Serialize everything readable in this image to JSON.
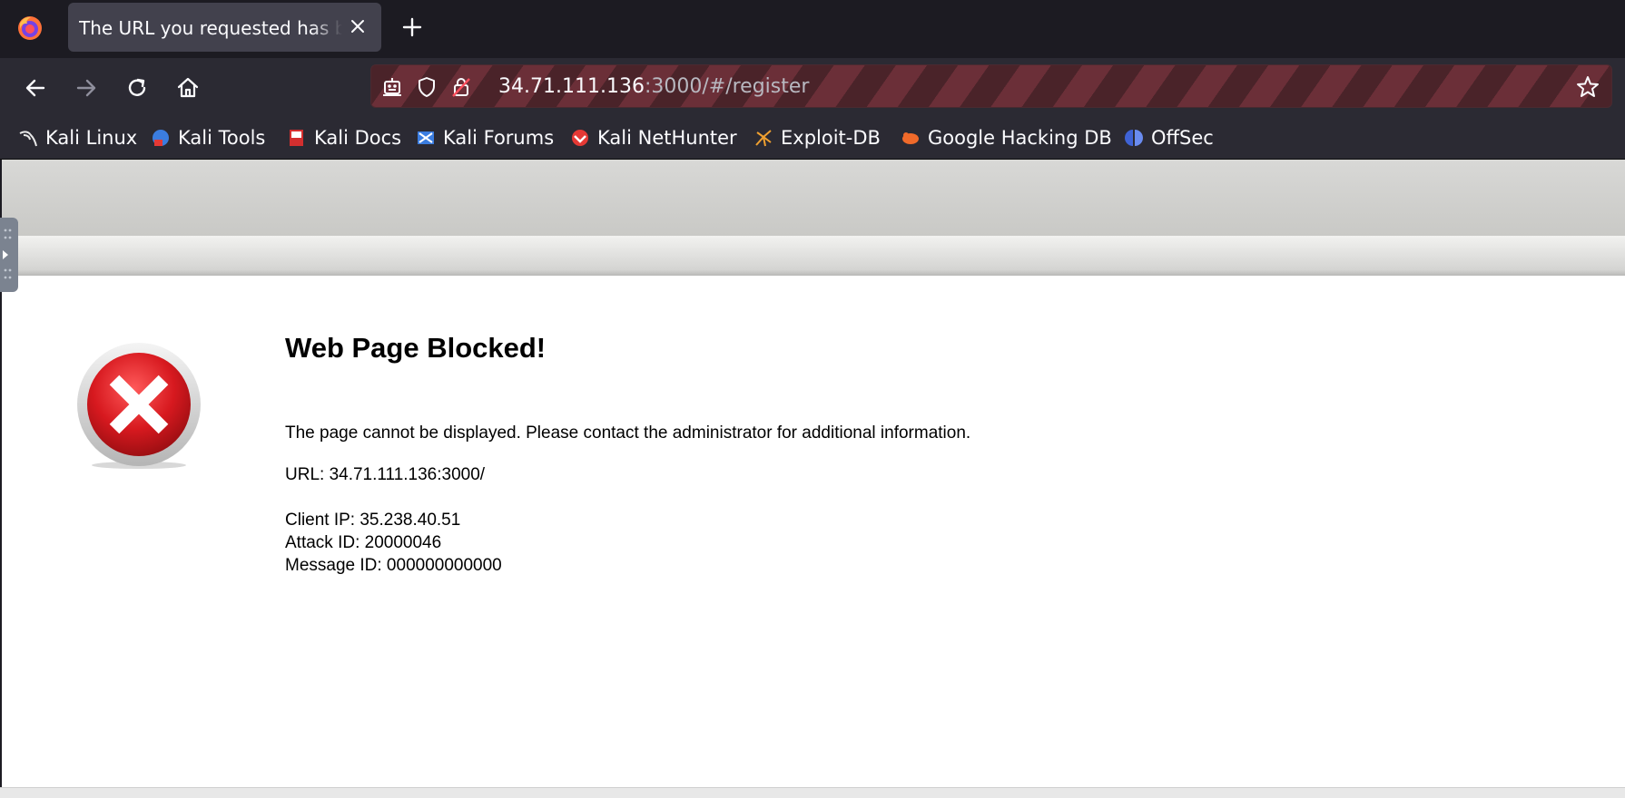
{
  "browser": {
    "tab": {
      "title": "The URL you requested has been blocked"
    },
    "nav": {
      "url_host": "34.71.111.136",
      "url_rest": ":3000/#/register"
    },
    "bookmarks": [
      {
        "label": "Kali Linux",
        "icon": "kali-dragon-icon"
      },
      {
        "label": "Kali Tools",
        "icon": "kali-tools-icon"
      },
      {
        "label": "Kali Docs",
        "icon": "kali-docs-icon"
      },
      {
        "label": "Kali Forums",
        "icon": "kali-forums-icon"
      },
      {
        "label": "Kali NetHunter",
        "icon": "kali-nethunter-icon"
      },
      {
        "label": "Exploit-DB",
        "icon": "exploit-db-icon"
      },
      {
        "label": "Google Hacking DB",
        "icon": "ghdb-icon"
      },
      {
        "label": "OffSec",
        "icon": "offsec-icon"
      }
    ]
  },
  "page": {
    "heading": "Web Page Blocked!",
    "message": "The page cannot be displayed. Please contact the administrator for additional information.",
    "url_line": "URL: 34.71.111.136:3000/",
    "client_ip": "Client IP: 35.238.40.51",
    "attack_id": "Attack ID: 20000046",
    "message_id": "Message ID: 000000000000"
  },
  "colors": {
    "tabstrip": "#1c1b22",
    "toolbar": "#2b2a33",
    "urlbar_stripe_a": "#4a2329",
    "urlbar_stripe_b": "#6b2f38",
    "error_red": "#d7191f"
  }
}
